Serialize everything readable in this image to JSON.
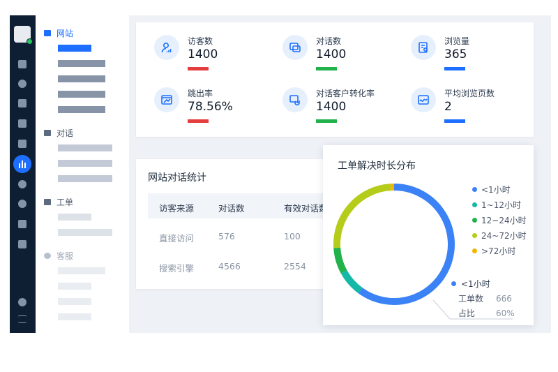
{
  "nav": {
    "sections": [
      {
        "label": "网站",
        "state": "active"
      },
      {
        "label": "对话",
        "state": "normal"
      },
      {
        "label": "工单",
        "state": "normal"
      },
      {
        "label": "客服",
        "state": "faded"
      }
    ]
  },
  "stats": [
    {
      "label": "访客数",
      "value": "1400",
      "bar_color": "#e53e3e",
      "icon": "visitor-icon"
    },
    {
      "label": "对话数",
      "value": "1400",
      "bar_color": "#22b24c",
      "icon": "chat-icon"
    },
    {
      "label": "浏览量",
      "value": "365",
      "bar_color": "#1e6fff",
      "icon": "pageview-icon"
    },
    {
      "label": "跳出率",
      "value": "78.56%",
      "bar_color": "#e53e3e",
      "icon": "bounce-icon"
    },
    {
      "label": "对话客户转化率",
      "value": "1400",
      "bar_color": "#22b24c",
      "icon": "conversion-icon"
    },
    {
      "label": "平均浏览页数",
      "value": "2",
      "bar_color": "#1e6fff",
      "icon": "avg-pages-icon"
    }
  ],
  "conv_table": {
    "title": "网站对话统计",
    "headers": [
      "访客来源",
      "对话数",
      "有效对话数"
    ],
    "rows": [
      [
        "直接访问",
        "576",
        "100"
      ],
      [
        "搜索引擎",
        "4566",
        "2554"
      ]
    ]
  },
  "chart_data": {
    "type": "pie",
    "title": "工单解决时长分布",
    "categories": [
      "<1小时",
      "1~12小时",
      "12~24小时",
      "24~72小时",
      ">72小时"
    ],
    "values": [
      60,
      7,
      7,
      25,
      1
    ],
    "colors": [
      "#3b82f6",
      "#14b8a6",
      "#22b24c",
      "#b5cc1a",
      "#f5b400"
    ],
    "legend": "right",
    "tooltip": {
      "series": "<1小时",
      "count_label": "工单数",
      "count_value": "666",
      "ratio_label": "占比",
      "ratio_value": "60%"
    }
  }
}
